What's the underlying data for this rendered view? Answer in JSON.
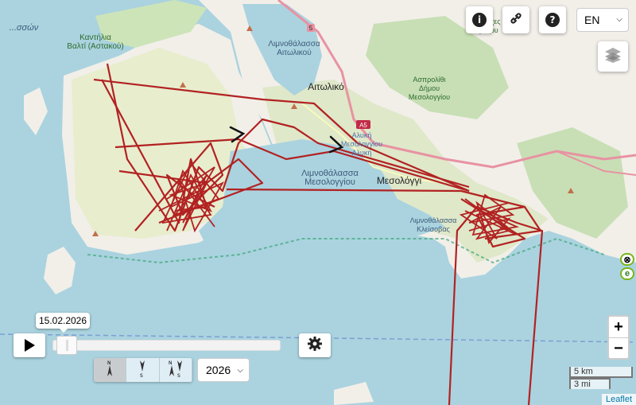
{
  "map": {
    "labels": {
      "sea_top_left": "...σσών",
      "kantilia": "Καντήλια\nΒαλτί (Αστακού)",
      "lagoon_aitoliko": "Λιμνοθάλασσα\nΑιτωλικού",
      "aitoliko": "Αιτωλικό",
      "lagoon_mesolongi": "Λιμνοθάλασσα\nΜεσολογγίου",
      "mesolongi": "Μεσολόγγι",
      "saltpans": "Αλυκή\nΜεσολογγίου\nΑλυκή",
      "lagoon_kleisova": "Λιμνοθάλασσα\nΚλείσοβας",
      "aspropyrgi": "Ασπρολίθι\nΔήμου\nΜεσολογγίου",
      "taxiarches": "Ταξιάρχες\nΤάραζου",
      "road_a5": "A5",
      "road_5": "5"
    },
    "track_color": "#b22222",
    "arrow_color": "#111111"
  },
  "top_controls": {
    "info_icon": "i",
    "link_icon": "link",
    "help_icon": "?",
    "language": "EN"
  },
  "timeline": {
    "date": "15.02.2026",
    "year": "2026",
    "progress": 0.02
  },
  "direction_buttons": [
    "N",
    "S",
    "NS"
  ],
  "zoom": {
    "in": "+",
    "out": "−"
  },
  "scale": {
    "km": "5 km",
    "mi": "3 mi"
  },
  "side_tabs": [
    "⊗",
    "e"
  ],
  "attribution": "Leaflet"
}
